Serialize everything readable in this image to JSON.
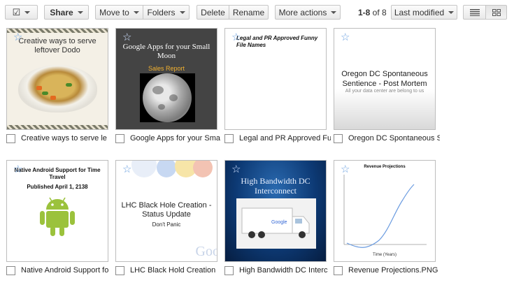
{
  "toolbar": {
    "select_checkbox_glyph": "☑",
    "share_label": "Share",
    "move_to_label": "Move to",
    "folders_label": "Folders",
    "delete_label": "Delete",
    "rename_label": "Rename",
    "more_actions_label": "More actions",
    "count_range": "1-8",
    "count_suffix": " of 8",
    "sort_label": "Last modified",
    "list_view_icon": "list-view-icon",
    "grid_view_icon": "grid-view-icon"
  },
  "colors": {
    "star": "#6aa0e0",
    "border": "#bdbdbd",
    "toolbar_button_top": "#fbfbfb",
    "toolbar_button_bottom": "#e9e9e9"
  },
  "docs": [
    {
      "caption": "Creative ways to serve le",
      "thumb_title": "Creative ways to serve leftover Dodo"
    },
    {
      "caption": "Google Apps for your Sma",
      "thumb_title": "Google Apps for your Small Moon",
      "thumb_subtitle": "Sales Report"
    },
    {
      "caption": "Legal and PR Approved Fu",
      "thumb_title": "Legal and PR Approved Funny File Names"
    },
    {
      "caption": "Oregon DC Spontaneous S",
      "thumb_title": "Oregon DC Spontaneous Sentience - Post Mortem",
      "thumb_subtitle": "All your data center are belong to us"
    },
    {
      "caption": "Native Android Support fo",
      "thumb_title": "Native Android Support for Time Travel",
      "thumb_subtitle": "Published April 1, 2138"
    },
    {
      "caption": "LHC Black Hold Creation",
      "thumb_title": "LHC Black Hole Creation - Status Update",
      "thumb_subtitle": "Don't Panic",
      "thumb_logo": "Goo"
    },
    {
      "caption": "High Bandwidth DC Interc",
      "thumb_title": "High Bandwidth DC Interconnect",
      "thumb_truck_logo": "Google"
    },
    {
      "caption": "Revenue Projections.PNG",
      "thumb_title": "Revenue Projections",
      "thumb_xlabel": "Time (Years)"
    }
  ]
}
